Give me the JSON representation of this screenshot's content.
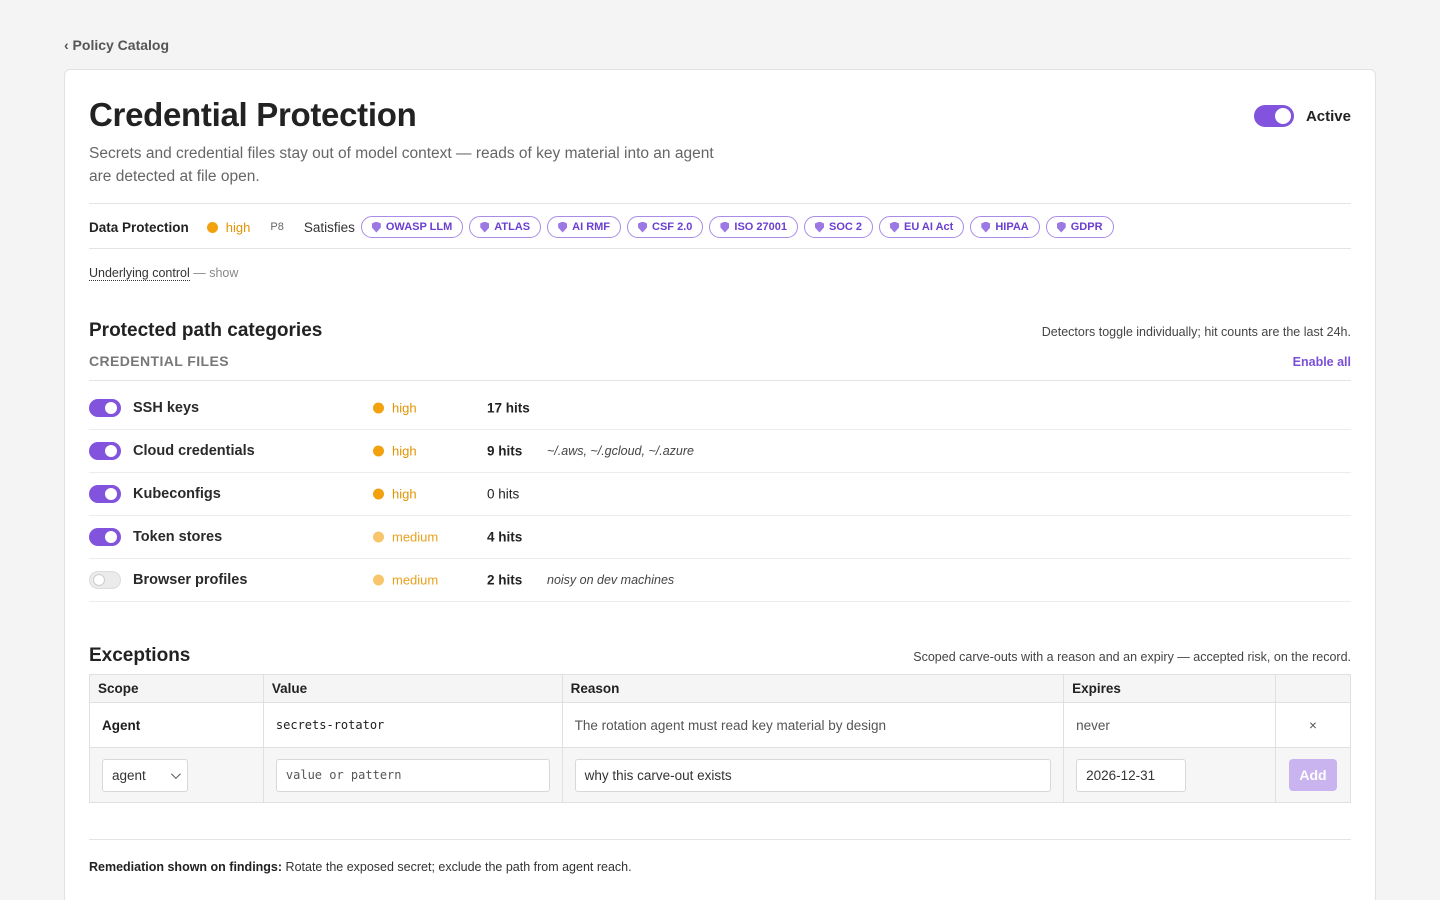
{
  "breadcrumb": {
    "back_label": "‹ Policy Catalog"
  },
  "policy": {
    "title": "Credential Protection",
    "description": "Secrets and credential files stay out of model context — reads of key material into an agent are detected at file open.",
    "active_label": "Active",
    "active": true,
    "category": "Data Protection",
    "severity": "high",
    "priority": "P8",
    "satisfies_label": "Satisfies",
    "frameworks": [
      "OWASP LLM",
      "ATLAS",
      "AI RMF",
      "CSF 2.0",
      "ISO 27001",
      "SOC 2",
      "EU AI Act",
      "HIPAA",
      "GDPR"
    ],
    "underlying_control_label": "Underlying control",
    "underlying_control_show": "— show"
  },
  "paths": {
    "title": "Protected path categories",
    "note": "Detectors toggle individually; hit counts are the last 24h.",
    "group_label": "CREDENTIAL FILES",
    "enable_all_label": "Enable all",
    "items": [
      {
        "name": "SSH keys",
        "enabled": true,
        "severity": "high",
        "hits": "17 hits",
        "extra": ""
      },
      {
        "name": "Cloud credentials",
        "enabled": true,
        "severity": "high",
        "hits": "9 hits",
        "extra": "~/.aws, ~/.gcloud, ~/.azure"
      },
      {
        "name": "Kubeconfigs",
        "enabled": true,
        "severity": "high",
        "hits": "0 hits",
        "extra": ""
      },
      {
        "name": "Token stores",
        "enabled": true,
        "severity": "medium",
        "hits": "4 hits",
        "extra": ""
      },
      {
        "name": "Browser profiles",
        "enabled": false,
        "severity": "medium",
        "hits": "2 hits",
        "extra": "noisy on dev machines"
      }
    ]
  },
  "exceptions": {
    "title": "Exceptions",
    "note": "Scoped carve-outs with a reason and an expiry — accepted risk, on the record.",
    "columns": [
      "Scope",
      "Value",
      "Reason",
      "Expires",
      ""
    ],
    "rows": [
      {
        "scope": "Agent",
        "value": "secrets-rotator",
        "reason": "The rotation agent must read key material by design",
        "expires": "never",
        "remove": "×"
      }
    ],
    "new": {
      "scope_selected": "agent",
      "value_placeholder": "value or pattern",
      "reason_placeholder": "why this carve-out exists",
      "expires_value": "2026-12-31",
      "add_label": "Add"
    }
  },
  "remediation": {
    "label": "Remediation shown on findings:",
    "text": "Rotate the exposed secret; exclude the path from agent reach."
  },
  "colors": {
    "accent": "#8253dc",
    "high": "#f2a20e",
    "medium": "#f7c56b"
  }
}
